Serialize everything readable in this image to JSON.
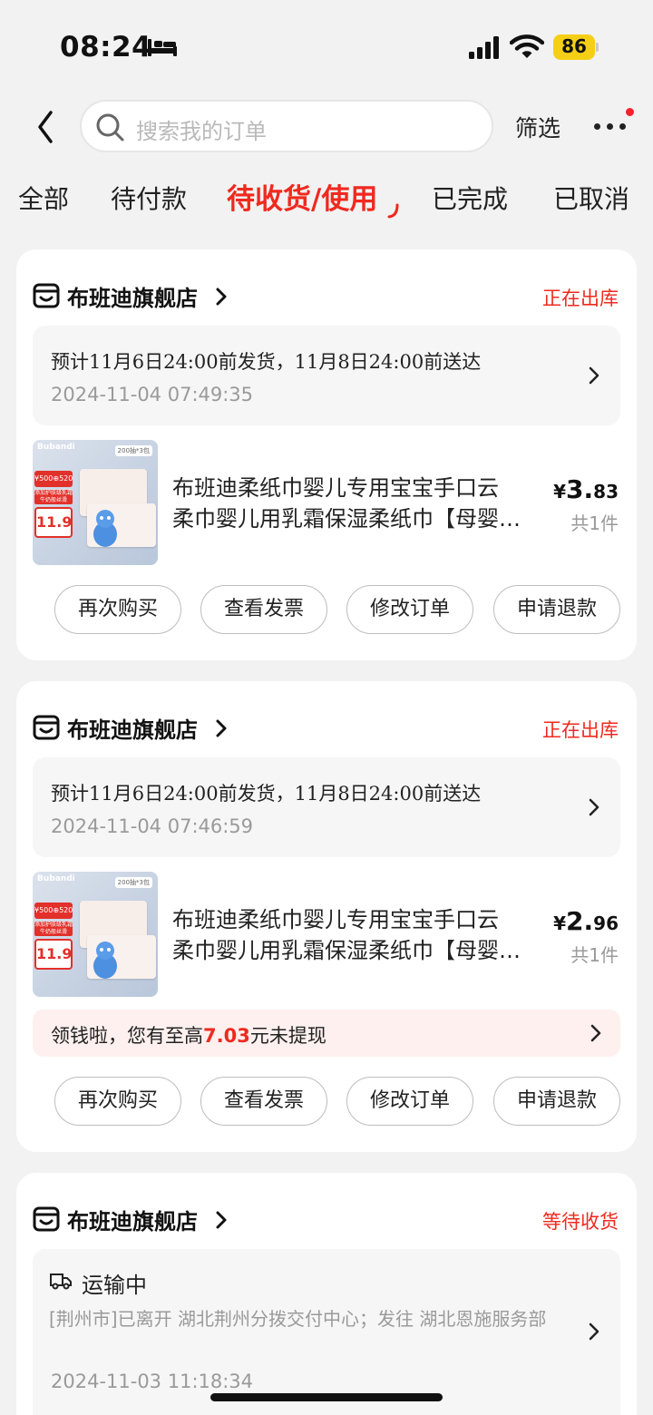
{
  "status_bar": {
    "time": "08:24",
    "battery": "86"
  },
  "search": {
    "placeholder": "搜索我的订单"
  },
  "header": {
    "filter_label": "筛选"
  },
  "tabs": [
    {
      "label": "全部"
    },
    {
      "label": "待付款"
    },
    {
      "label": "待收货/使用"
    },
    {
      "label": "已完成"
    },
    {
      "label": "已取消"
    }
  ],
  "orders": [
    {
      "store_name": "布班迪旗舰店",
      "status": "正在出库",
      "shipping_note": "预计11月6日24:00前发货，11月8日24:00前送达",
      "order_time": "2024-11-04 07:49:35",
      "product": {
        "title_line1": "布班迪柔纸巾婴儿专用宝宝手口云",
        "title_line2": "柔巾婴儿用乳霜保湿柔纸巾【母婴…",
        "price_currency": "¥",
        "price_int": "3.",
        "price_dec": "83",
        "quantity": "共1件",
        "image": {
          "brand": "Bubandi",
          "tag": "200抽*3包",
          "badge": "¥500⊕520",
          "banner": "添加护肤级乳霜 牛奶般丝滑",
          "price": "11.9"
        }
      },
      "buttons": [
        "再次购买",
        "查看发票",
        "修改订单",
        "申请退款"
      ]
    },
    {
      "store_name": "布班迪旗舰店",
      "status": "正在出库",
      "shipping_note": "预计11月6日24:00前发货，11月8日24:00前送达",
      "order_time": "2024-11-04 07:46:59",
      "product": {
        "title_line1": "布班迪柔纸巾婴儿专用宝宝手口云",
        "title_line2": "柔巾婴儿用乳霜保湿柔纸巾【母婴…",
        "price_currency": "¥",
        "price_int": "2.",
        "price_dec": "96",
        "quantity": "共1件",
        "image": {
          "brand": "Bubandi",
          "tag": "200抽*3包",
          "badge": "¥500⊕520",
          "banner": "添加护肤级乳霜 牛奶般丝滑",
          "price": "11.9"
        }
      },
      "promo": {
        "prefix": "领钱啦，您有至高",
        "amount": "7.03",
        "suffix": "元未提现"
      },
      "buttons": [
        "再次购买",
        "查看发票",
        "修改订单",
        "申请退款"
      ]
    },
    {
      "store_name": "布班迪旗舰店",
      "status": "等待收货",
      "logistics_status": "运输中",
      "logistics_detail": "[荆州市]已离开 湖北荆州分拨交付中心；发往 湖北恩施服务部",
      "order_time": "2024-11-03 11:18:34"
    }
  ],
  "colors": {
    "accent": "#ef2a1f",
    "battery": "#f5cf16",
    "background": "#f2f2f2"
  }
}
